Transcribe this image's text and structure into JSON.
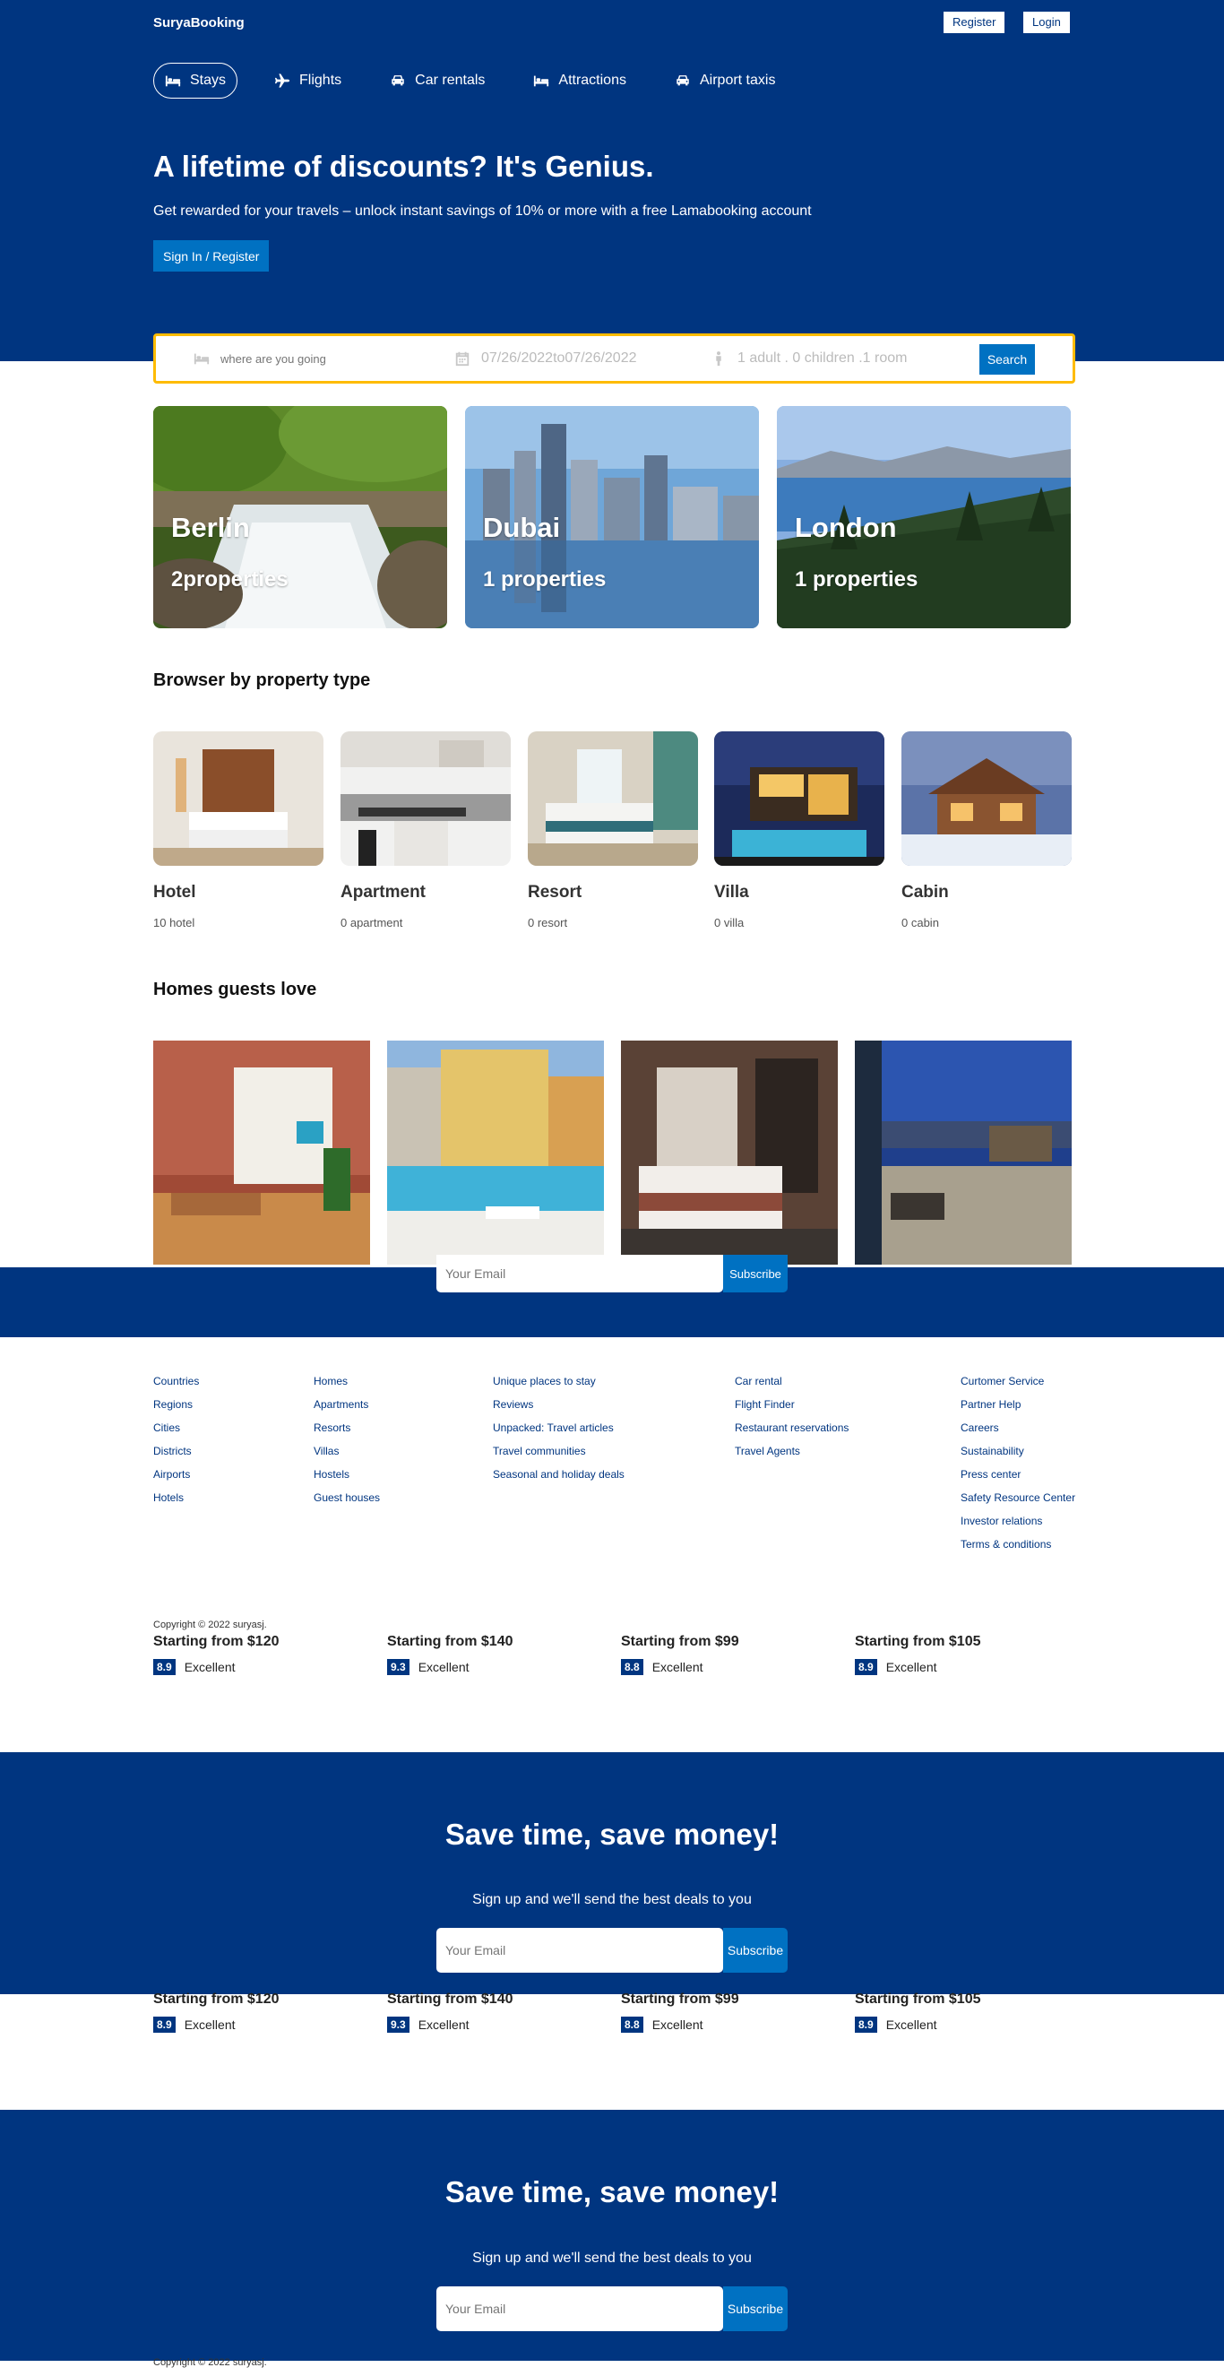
{
  "header": {
    "brand": "SuryaBooking",
    "register_label": "Register",
    "login_label": "Login"
  },
  "nav": {
    "tabs": [
      {
        "label": "Stays",
        "icon": "bed-icon",
        "active": true
      },
      {
        "label": "Flights",
        "icon": "plane-icon"
      },
      {
        "label": "Car rentals",
        "icon": "car-icon"
      },
      {
        "label": "Attractions",
        "icon": "bed-icon"
      },
      {
        "label": "Airport taxis",
        "icon": "taxi-icon"
      }
    ]
  },
  "hero": {
    "title": "A lifetime of discounts? It's Genius.",
    "description": "Get rewarded for your travels – unlock instant savings of 10% or more with a free Lamabooking account",
    "button_label": "Sign In / Register"
  },
  "search": {
    "destination_placeholder": "where are you going",
    "dates": "07/26/2022to07/26/2022",
    "guests": "1 adult . 0 children .1 room",
    "button_label": "Search"
  },
  "featured": [
    {
      "city": "Berlin",
      "properties": "2properties"
    },
    {
      "city": "Dubai",
      "properties": "1 properties"
    },
    {
      "city": "London",
      "properties": "1 properties"
    }
  ],
  "property_types": {
    "title": "Browser by property type",
    "items": [
      {
        "name": "Hotel",
        "count": "10 hotel"
      },
      {
        "name": "Apartment",
        "count": "0 apartment"
      },
      {
        "name": "Resort",
        "count": "0 resort"
      },
      {
        "name": "Villa",
        "count": "0 villa"
      },
      {
        "name": "Cabin",
        "count": "0 cabin"
      }
    ]
  },
  "homes": {
    "title": "Homes guests love"
  },
  "overlap_strip": {
    "email_placeholder": "Your Email",
    "button_label": "Subscribe"
  },
  "footer": {
    "columns": [
      [
        "Countries",
        "Regions",
        "Cities",
        "Districts",
        "Airports",
        "Hotels"
      ],
      [
        "Homes",
        "Apartments",
        "Resorts",
        "Villas",
        "Hostels",
        "Guest houses"
      ],
      [
        "Unique places to stay",
        "Reviews",
        "Unpacked: Travel articles",
        "Travel communities",
        "Seasonal and holiday deals"
      ],
      [
        "Car rental",
        "Flight Finder",
        "Restaurant reservations",
        "Travel Agents"
      ],
      [
        "Curtomer Service",
        "Partner Help",
        "Careers",
        "Sustainability",
        "Press center",
        "Safety Resource Center",
        "Investor relations",
        "Terms & conditions"
      ]
    ],
    "copyright": "Copyright © 2022 suryasj."
  },
  "homes_stats": [
    {
      "price": "Starting from $120",
      "rating": "8.9",
      "label": "Excellent"
    },
    {
      "price": "Starting from $140",
      "rating": "9.3",
      "label": "Excellent"
    },
    {
      "price": "Starting from $99",
      "rating": "8.8",
      "label": "Excellent"
    },
    {
      "price": "Starting from $105",
      "rating": "8.9",
      "label": "Excellent"
    }
  ],
  "newsletter": {
    "title": "Save time, save money!",
    "description": "Sign up and we'll send the best deals to you",
    "email_placeholder": "Your Email",
    "button_label": "Subscribe"
  },
  "colors": {
    "brand_navy": "#003580",
    "accent_blue": "#0071c2",
    "search_border": "#febb02"
  }
}
